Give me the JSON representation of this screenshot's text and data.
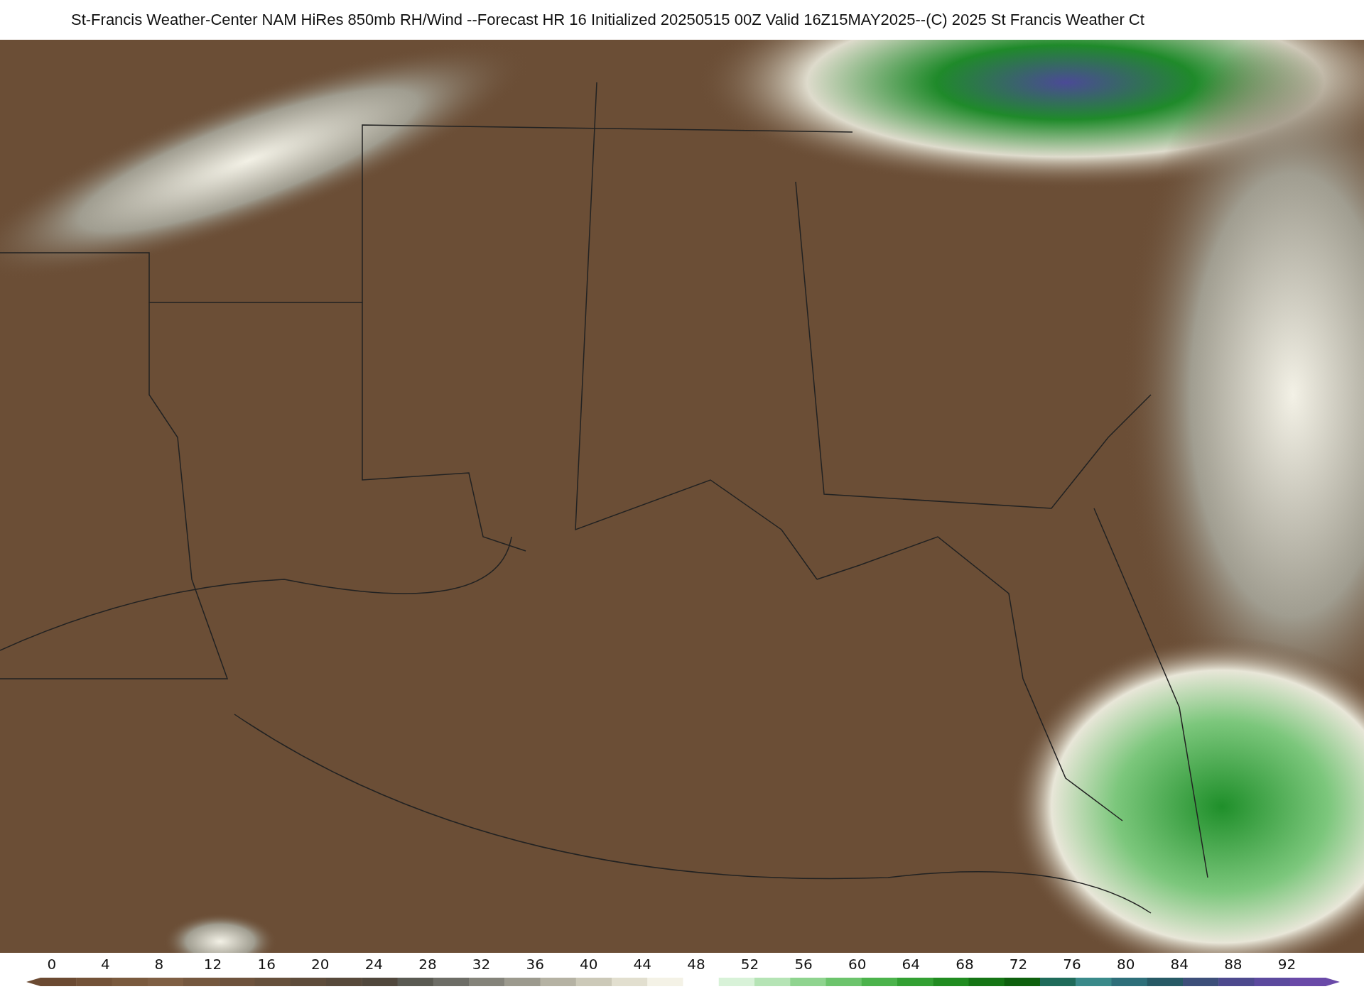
{
  "title": "St-Francis Weather-Center NAM HiRes 850mb RH/Wind  --Forecast HR 16 Initialized 20250515 00Z Valid 16Z15MAY2025--(C) 2025 St Francis Weather Ct",
  "colorbar": {
    "ticks": [
      "0",
      "4",
      "8",
      "12",
      "16",
      "20",
      "24",
      "28",
      "32",
      "36",
      "40",
      "44",
      "48",
      "52",
      "56",
      "60",
      "64",
      "68",
      "72",
      "76",
      "80",
      "84",
      "88",
      "92"
    ]
  }
}
